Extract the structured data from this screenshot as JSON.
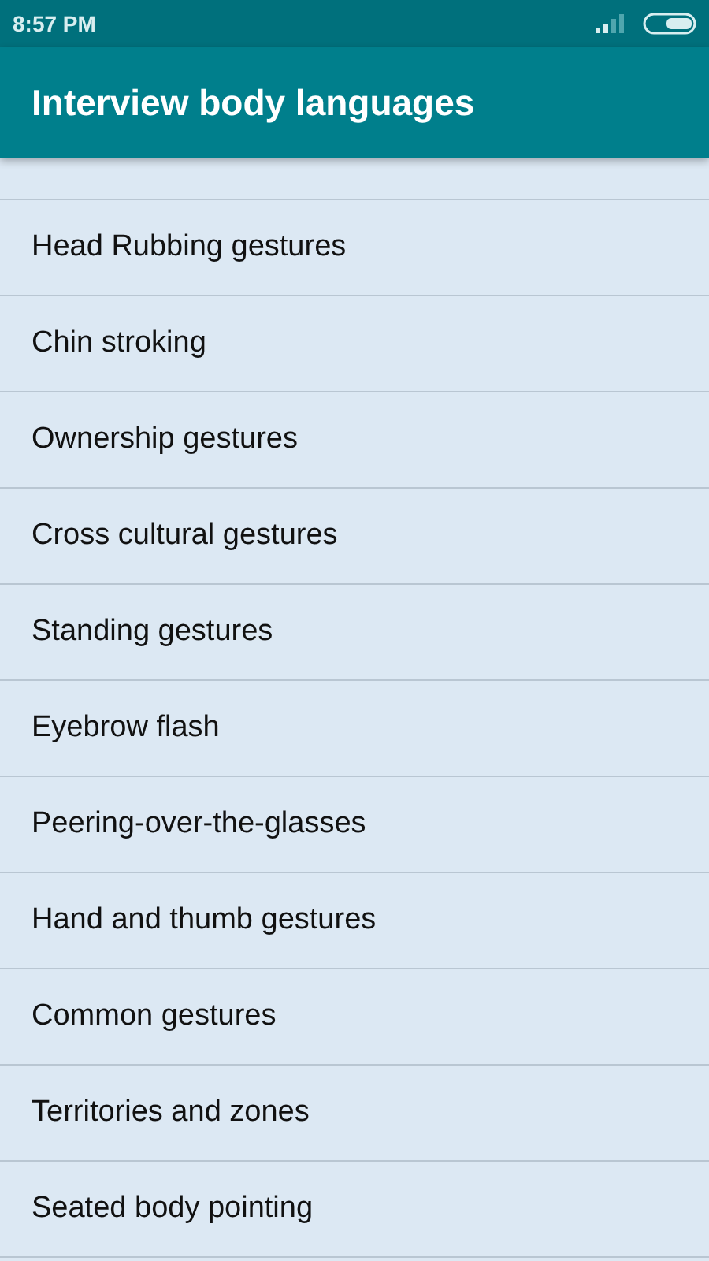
{
  "status_bar": {
    "time": "8:57 PM"
  },
  "app_bar": {
    "title": "Interview body languages"
  },
  "items": [
    {
      "label": "Head Rubbing gestures"
    },
    {
      "label": "Chin stroking"
    },
    {
      "label": "Ownership gestures"
    },
    {
      "label": "Cross cultural gestures"
    },
    {
      "label": "Standing gestures"
    },
    {
      "label": "Eyebrow flash"
    },
    {
      "label": "Peering-over-the-glasses"
    },
    {
      "label": "Hand and thumb gestures"
    },
    {
      "label": "Common gestures"
    },
    {
      "label": "Territories and zones"
    },
    {
      "label": "Seated body pointing"
    }
  ]
}
